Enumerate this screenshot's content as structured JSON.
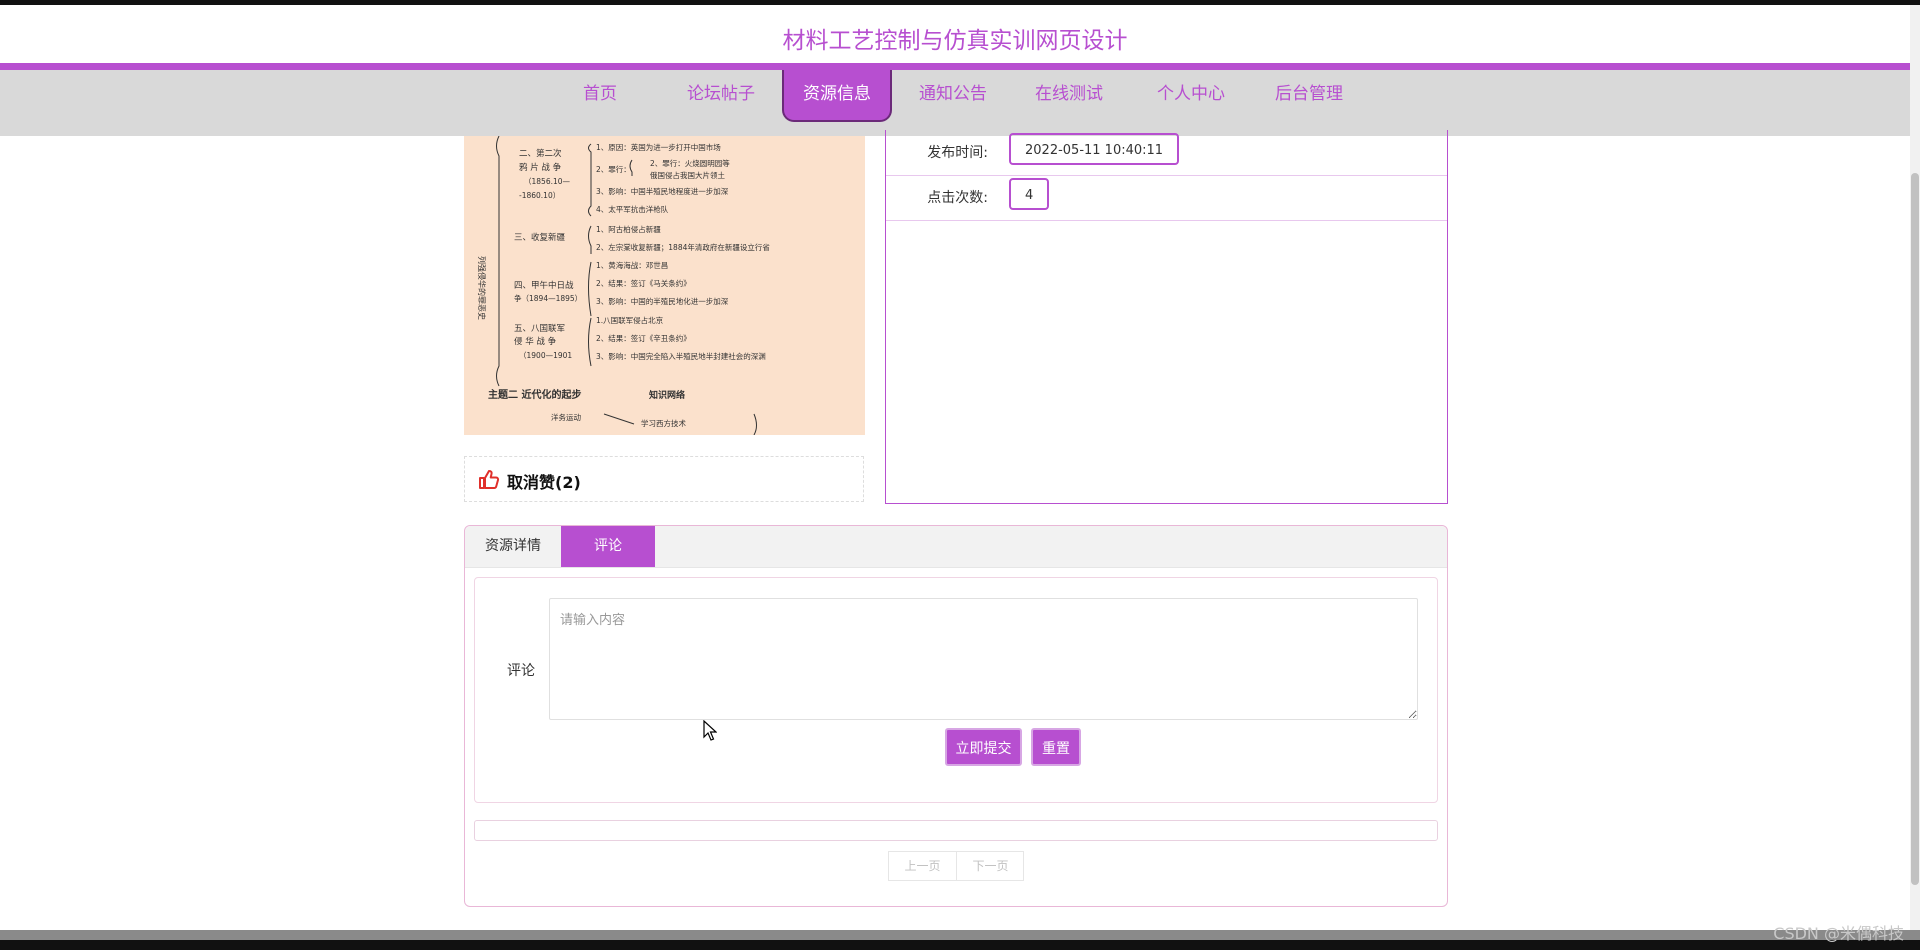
{
  "site": {
    "title": "材料工艺控制与仿真实训网页设计"
  },
  "nav": {
    "items": [
      {
        "label": "首页"
      },
      {
        "label": "论坛帖子"
      },
      {
        "label": "资源信息"
      },
      {
        "label": "通知公告"
      },
      {
        "label": "在线测试"
      },
      {
        "label": "个人中心"
      },
      {
        "label": "后台管理"
      }
    ],
    "active_index": 2
  },
  "resource_image": {
    "lines": [
      "二、第二次",
      "鸦 片 战 争",
      "（1856.10—",
      "-1860.10）",
      "1、原因：英国为进一步打开中国市场",
      "2、罪行：火烧圆明园等",
      "俄国侵占我国大片领土",
      "3、影响：中国半殖民地程度进一步加深",
      "4、太平军抗击洋枪队",
      "三、收复新疆",
      "1、阿古柏侵占新疆",
      "2、左宗棠收复新疆；1884年清政府在新疆设立行省",
      "四、甲午中日战",
      "争（1894—1895）",
      "1、黄海海战：邓世昌",
      "2、结果：签订《马关条约》",
      "3、影响：中国的半殖民地化进一步加深",
      "五、八国联军",
      "侵 华 战 争",
      "（1900—1901",
      "1.八国联军侵占北京",
      "2、结果：签订《辛丑条约》",
      "3、影响：中国完全陷入半殖民地半封建社会的深渊",
      "主题二 近代化的起步",
      "知识网络",
      "洋务运动",
      "学习西方技术",
      "列强侵华的罪恶史"
    ]
  },
  "like": {
    "label": "取消赞(2)"
  },
  "info": {
    "publish_time_label": "发布时间:",
    "publish_time_value": "2022-05-11 10:40:11",
    "clicks_label": "点击次数:",
    "clicks_value": "4"
  },
  "tabs": {
    "items": [
      {
        "label": "资源详情"
      },
      {
        "label": "评论"
      }
    ],
    "active_index": 1
  },
  "comment_form": {
    "label": "评论",
    "placeholder": "请输入内容",
    "value": "",
    "submit_label": "立即提交",
    "reset_label": "重置"
  },
  "pager": {
    "prev_label": "上一页",
    "next_label": "下一页"
  },
  "watermark": "CSDN @米偶科技",
  "colors": {
    "accent": "#b74fd0",
    "nav_bg": "#d9d9d9",
    "image_bg": "#fbe1cc",
    "like_icon": "#e0302b"
  }
}
